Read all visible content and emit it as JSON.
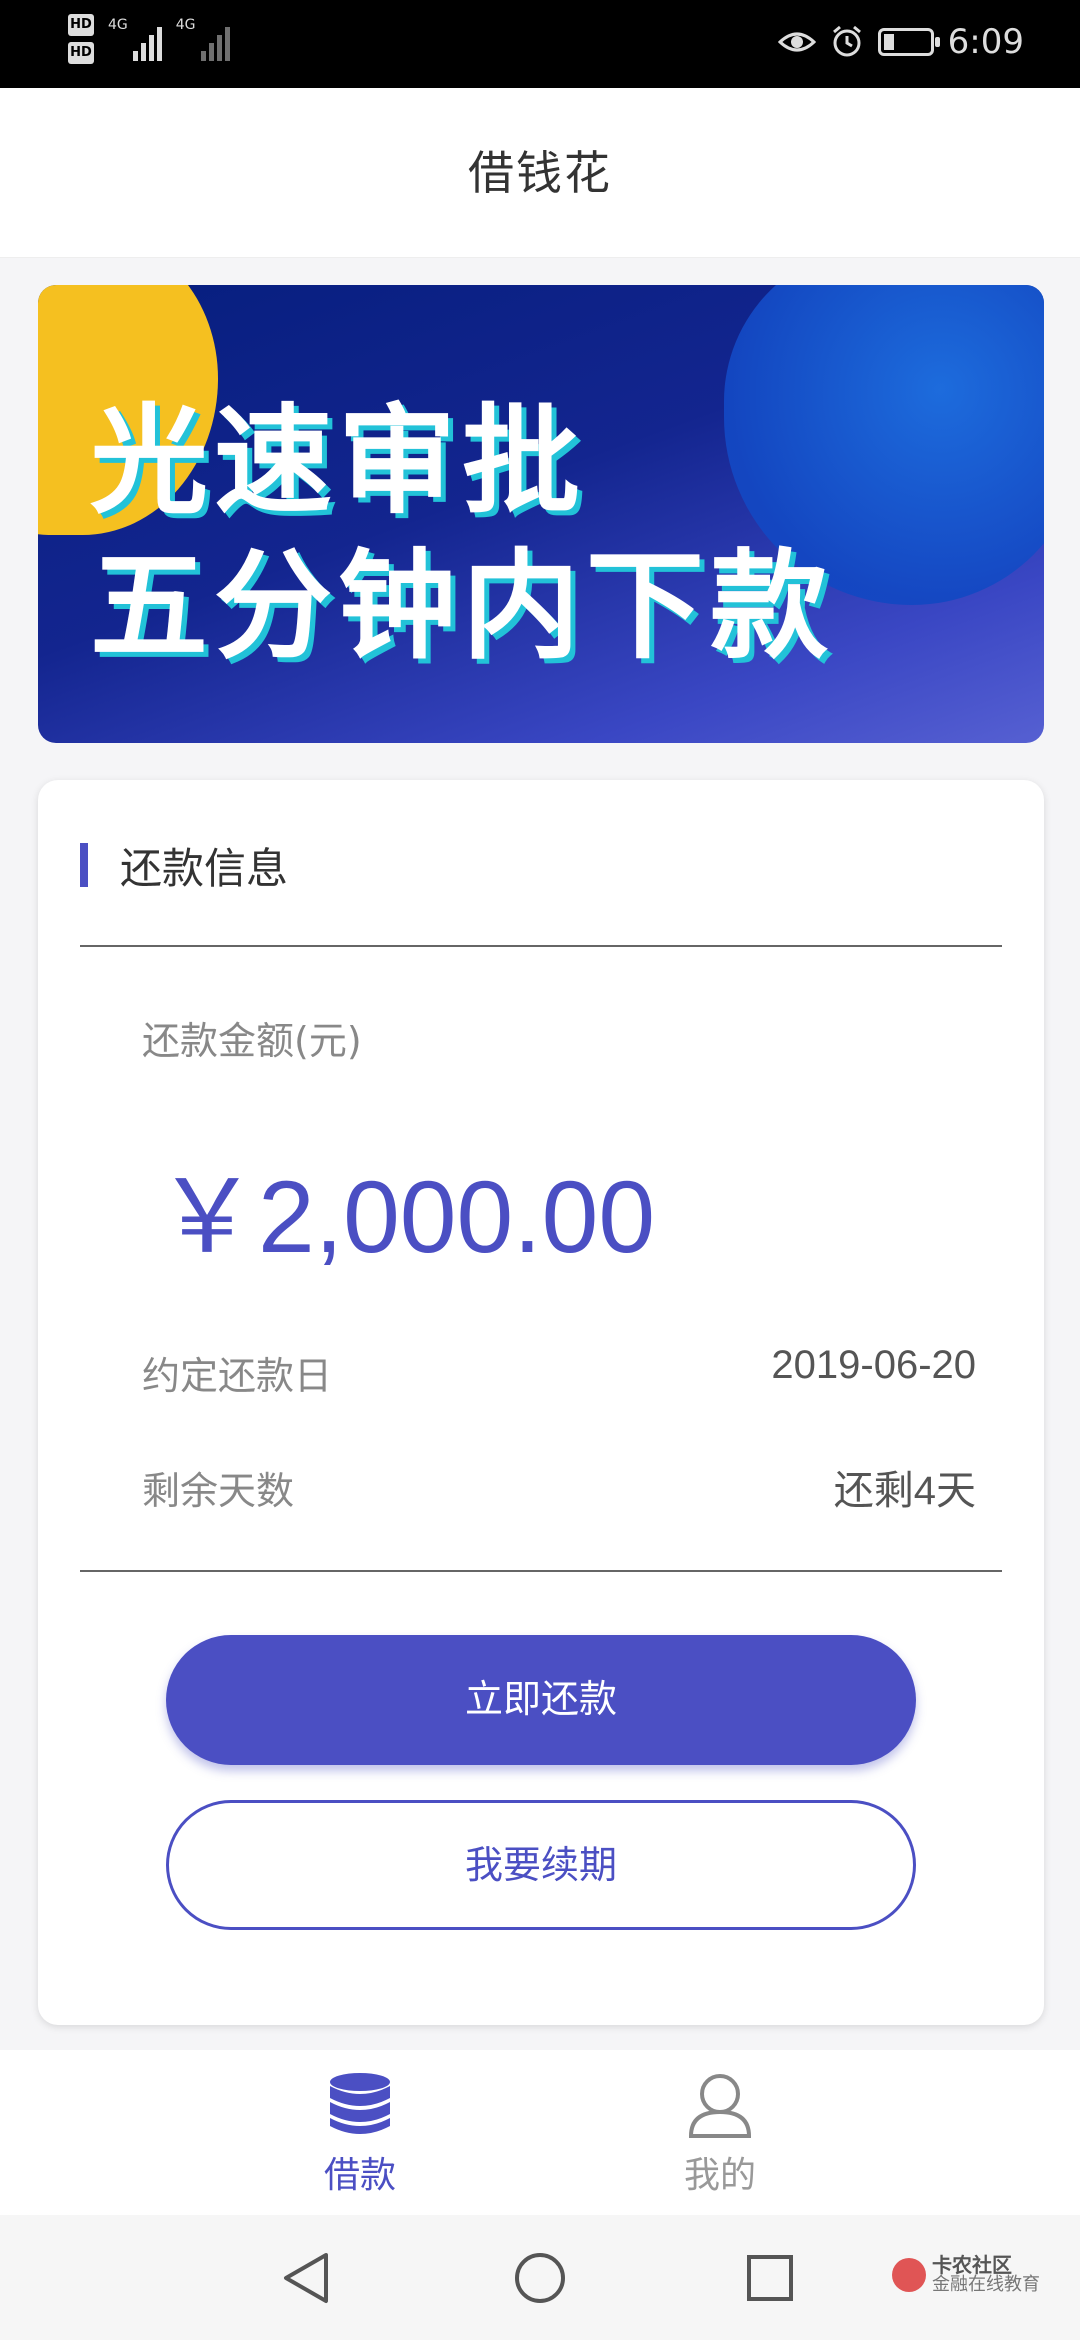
{
  "status_bar": {
    "hd1": "HD",
    "hd2": "HD",
    "signal1_label": "4G",
    "signal2_label": "4G",
    "time": "6:09",
    "icons": [
      "eye-icon",
      "alarm-icon",
      "battery-icon"
    ]
  },
  "header": {
    "title": "借钱花"
  },
  "banner": {
    "line1": "光速审批",
    "line2": "五分钟内下款"
  },
  "repayment": {
    "section_title": "还款信息",
    "amount_label": "还款金额(元)",
    "amount": "￥2,000.00",
    "due_date_label": "约定还款日",
    "due_date": "2019-06-20",
    "days_left_label": "剩余天数",
    "days_left": "还剩4天",
    "repay_button": "立即还款",
    "renew_button": "我要续期"
  },
  "tabbar": {
    "tabs": [
      {
        "label": "借款",
        "icon": "database-icon",
        "active": true
      },
      {
        "label": "我的",
        "icon": "user-icon",
        "active": false
      }
    ]
  },
  "watermark": {
    "title": "卡农社区",
    "subtitle": "金融在线教育"
  },
  "colors": {
    "accent": "#4b4fc3",
    "banner_bg": "#13258f",
    "banner_yellow": "#f5c020"
  }
}
